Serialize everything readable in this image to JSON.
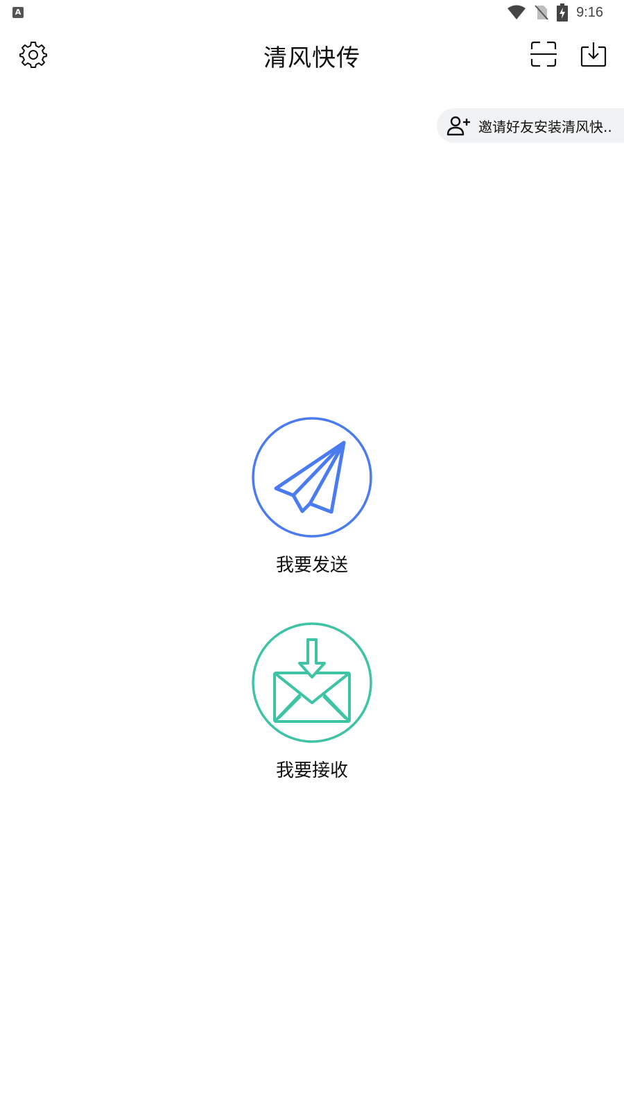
{
  "status_bar": {
    "app_indicator": "A",
    "time": "9:16",
    "icons": [
      "wifi-icon",
      "no-sim-icon",
      "battery-charging-icon"
    ]
  },
  "app_bar": {
    "title": "清风快传",
    "left_icon": "gear-icon",
    "right_icons": [
      "scan-icon",
      "download-tray-icon"
    ]
  },
  "invite": {
    "icon": "add-user-icon",
    "label": "邀请好友安装清风快.."
  },
  "actions": {
    "send": {
      "label": "我要发送",
      "icon": "paper-plane-icon",
      "color": "#4a7bf0"
    },
    "receive": {
      "label": "我要接收",
      "icon": "envelope-download-icon",
      "color": "#3ec4a5"
    }
  }
}
